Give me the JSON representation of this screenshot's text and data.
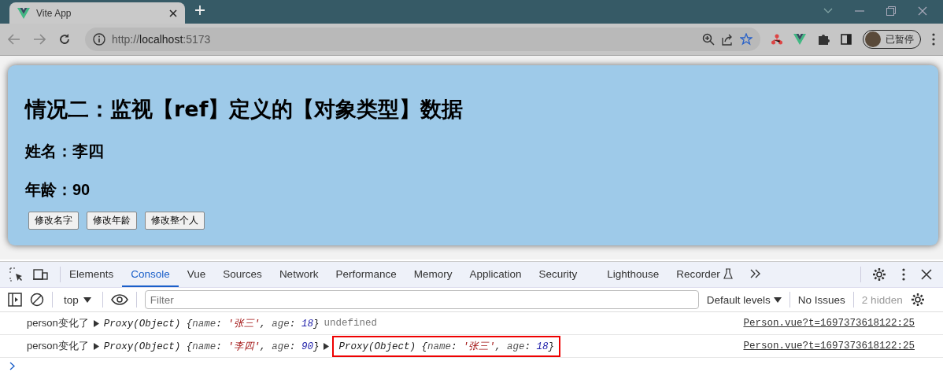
{
  "browser": {
    "tab_title": "Vite App",
    "url": [
      {
        "text": "http://",
        "kind": "dim"
      },
      {
        "text": "localhost",
        "kind": "host"
      },
      {
        "text": ":5173",
        "kind": "dim"
      }
    ],
    "profile_label": "已暂停"
  },
  "page": {
    "title": "情况二：监视【ref】定义的【对象类型】数据",
    "name_line": "姓名：李四",
    "age_line": "年龄：90",
    "buttons": [
      "修改名字",
      "修改年龄",
      "修改整个人"
    ]
  },
  "devtools": {
    "tabs": [
      {
        "label": "Elements",
        "selected": false
      },
      {
        "label": "Console",
        "selected": true
      },
      {
        "label": "Vue",
        "selected": false
      },
      {
        "label": "Sources",
        "selected": false
      },
      {
        "label": "Network",
        "selected": false
      },
      {
        "label": "Performance",
        "selected": false
      },
      {
        "label": "Memory",
        "selected": false
      },
      {
        "label": "Application",
        "selected": false
      },
      {
        "label": "Security",
        "selected": false
      },
      {
        "label": "Lighthouse",
        "selected": false
      },
      {
        "label": "Recorder",
        "selected": false
      }
    ],
    "context": "top",
    "filter_placeholder": "Filter",
    "levels": "Default levels",
    "issues": "No Issues",
    "hidden": "2 hidden",
    "messages": [
      {
        "text": "person变化了",
        "source": "Person.vue?t=1697373618122:25",
        "args": [
          {
            "kind": "object",
            "highlighted": false,
            "segments": [
              {
                "text": "Proxy(Object) {",
                "kind": "punct"
              },
              {
                "text": "name",
                "kind": "key"
              },
              {
                "text": ": ",
                "kind": "punct"
              },
              {
                "text": "'张三'",
                "kind": "string"
              },
              {
                "text": ", ",
                "kind": "punct"
              },
              {
                "text": "age",
                "kind": "key"
              },
              {
                "text": ": ",
                "kind": "punct"
              },
              {
                "text": "18",
                "kind": "number"
              },
              {
                "text": "}",
                "kind": "punct"
              }
            ]
          },
          {
            "kind": "undefined",
            "text": "undefined"
          }
        ]
      },
      {
        "text": "person变化了",
        "source": "Person.vue?t=1697373618122:25",
        "args": [
          {
            "kind": "object",
            "highlighted": false,
            "segments": [
              {
                "text": "Proxy(Object) {",
                "kind": "punct"
              },
              {
                "text": "name",
                "kind": "key"
              },
              {
                "text": ": ",
                "kind": "punct"
              },
              {
                "text": "'李四'",
                "kind": "string"
              },
              {
                "text": ", ",
                "kind": "punct"
              },
              {
                "text": "age",
                "kind": "key"
              },
              {
                "text": ": ",
                "kind": "punct"
              },
              {
                "text": "90",
                "kind": "number"
              },
              {
                "text": "}",
                "kind": "punct"
              }
            ]
          },
          {
            "kind": "object",
            "highlighted": true,
            "segments": [
              {
                "text": "Proxy(Object) {",
                "kind": "punct"
              },
              {
                "text": "name",
                "kind": "key"
              },
              {
                "text": ": ",
                "kind": "punct"
              },
              {
                "text": "'张三'",
                "kind": "string"
              },
              {
                "text": ", ",
                "kind": "punct"
              },
              {
                "text": "age",
                "kind": "key"
              },
              {
                "text": ": ",
                "kind": "punct"
              },
              {
                "text": "18",
                "kind": "number"
              },
              {
                "text": "}",
                "kind": "punct"
              }
            ]
          }
        ]
      }
    ]
  }
}
